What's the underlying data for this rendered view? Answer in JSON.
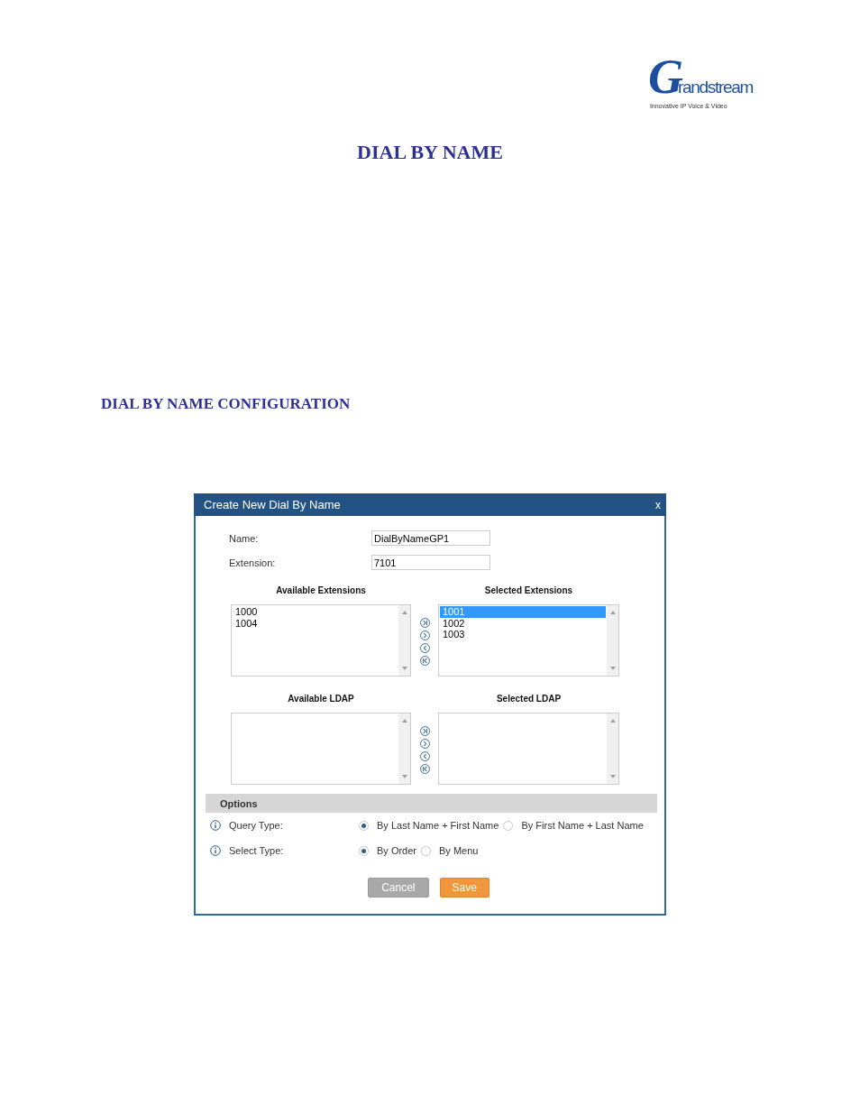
{
  "logo": {
    "name": "Grandstream",
    "tagline": "Innovative IP Voice & Video"
  },
  "page_title": "DIAL BY NAME",
  "section_title": "DIAL BY NAME CONFIGURATION",
  "dialog": {
    "title": "Create New Dial By Name",
    "close": "x",
    "fields": [
      {
        "label": "Name:",
        "value": "DialByNameGP1"
      },
      {
        "label": "Extension:",
        "value": "7101"
      }
    ],
    "pickers": [
      {
        "available": {
          "heading": "Available Extensions",
          "items": [
            {
              "label": "1000",
              "selected": false
            },
            {
              "label": "1004",
              "selected": false
            }
          ]
        },
        "chosen": {
          "heading": "Selected Extensions",
          "items": [
            {
              "label": "1001",
              "selected": true
            },
            {
              "label": "1002",
              "selected": false
            },
            {
              "label": "1003",
              "selected": false
            }
          ]
        }
      },
      {
        "available": {
          "heading": "Available LDAP"
        },
        "chosen": {
          "heading": "Selected LDAP"
        }
      }
    ],
    "options": {
      "heading": "Options",
      "rows": [
        {
          "label": "Query Type:",
          "choices": [
            {
              "label": "By Last Name + First Name",
              "selected": true
            },
            {
              "label": "By First Name + Last Name",
              "selected": false
            }
          ]
        },
        {
          "label": "Select Type:",
          "choices": [
            {
              "label": "By Order",
              "selected": true
            },
            {
              "label": "By Menu",
              "selected": false
            }
          ]
        }
      ]
    },
    "buttons": [
      {
        "label": "Cancel",
        "kind": "secondary"
      },
      {
        "label": "Save",
        "kind": "primary"
      }
    ]
  }
}
